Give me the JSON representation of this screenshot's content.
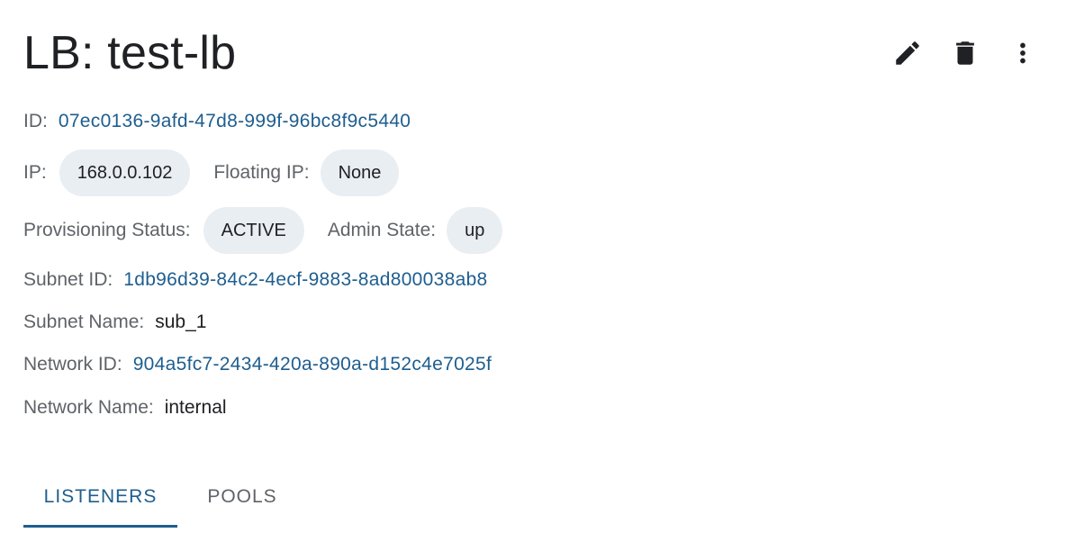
{
  "header": {
    "title": "LB: test-lb",
    "actions": [
      {
        "icon": "edit-icon"
      },
      {
        "icon": "delete-icon"
      },
      {
        "icon": "more-vertical-icon"
      }
    ]
  },
  "details": {
    "id": {
      "label": "ID:",
      "value": "07ec0136-9afd-47d8-999f-96bc8f9c5440"
    },
    "ip": {
      "label": "IP:",
      "value": "168.0.0.102"
    },
    "floating_ip": {
      "label": "Floating IP:",
      "value": "None"
    },
    "provisioning_status": {
      "label": "Provisioning Status:",
      "value": "ACTIVE"
    },
    "admin_state": {
      "label": "Admin State:",
      "value": "up"
    },
    "subnet_id": {
      "label": "Subnet ID:",
      "value": "1db96d39-84c2-4ecf-9883-8ad800038ab8"
    },
    "subnet_name": {
      "label": "Subnet Name:",
      "value": "sub_1"
    },
    "network_id": {
      "label": "Network ID:",
      "value": "904a5fc7-2434-420a-890a-d152c4e7025f"
    },
    "network_name": {
      "label": "Network Name:",
      "value": "internal"
    }
  },
  "tabs": [
    {
      "label": "LISTENERS",
      "active": true
    },
    {
      "label": "POOLS",
      "active": false
    }
  ],
  "colors": {
    "accent": "#1e5e8f",
    "chip_background": "#e9eef2",
    "label": "#5f6368",
    "text": "#202124"
  }
}
